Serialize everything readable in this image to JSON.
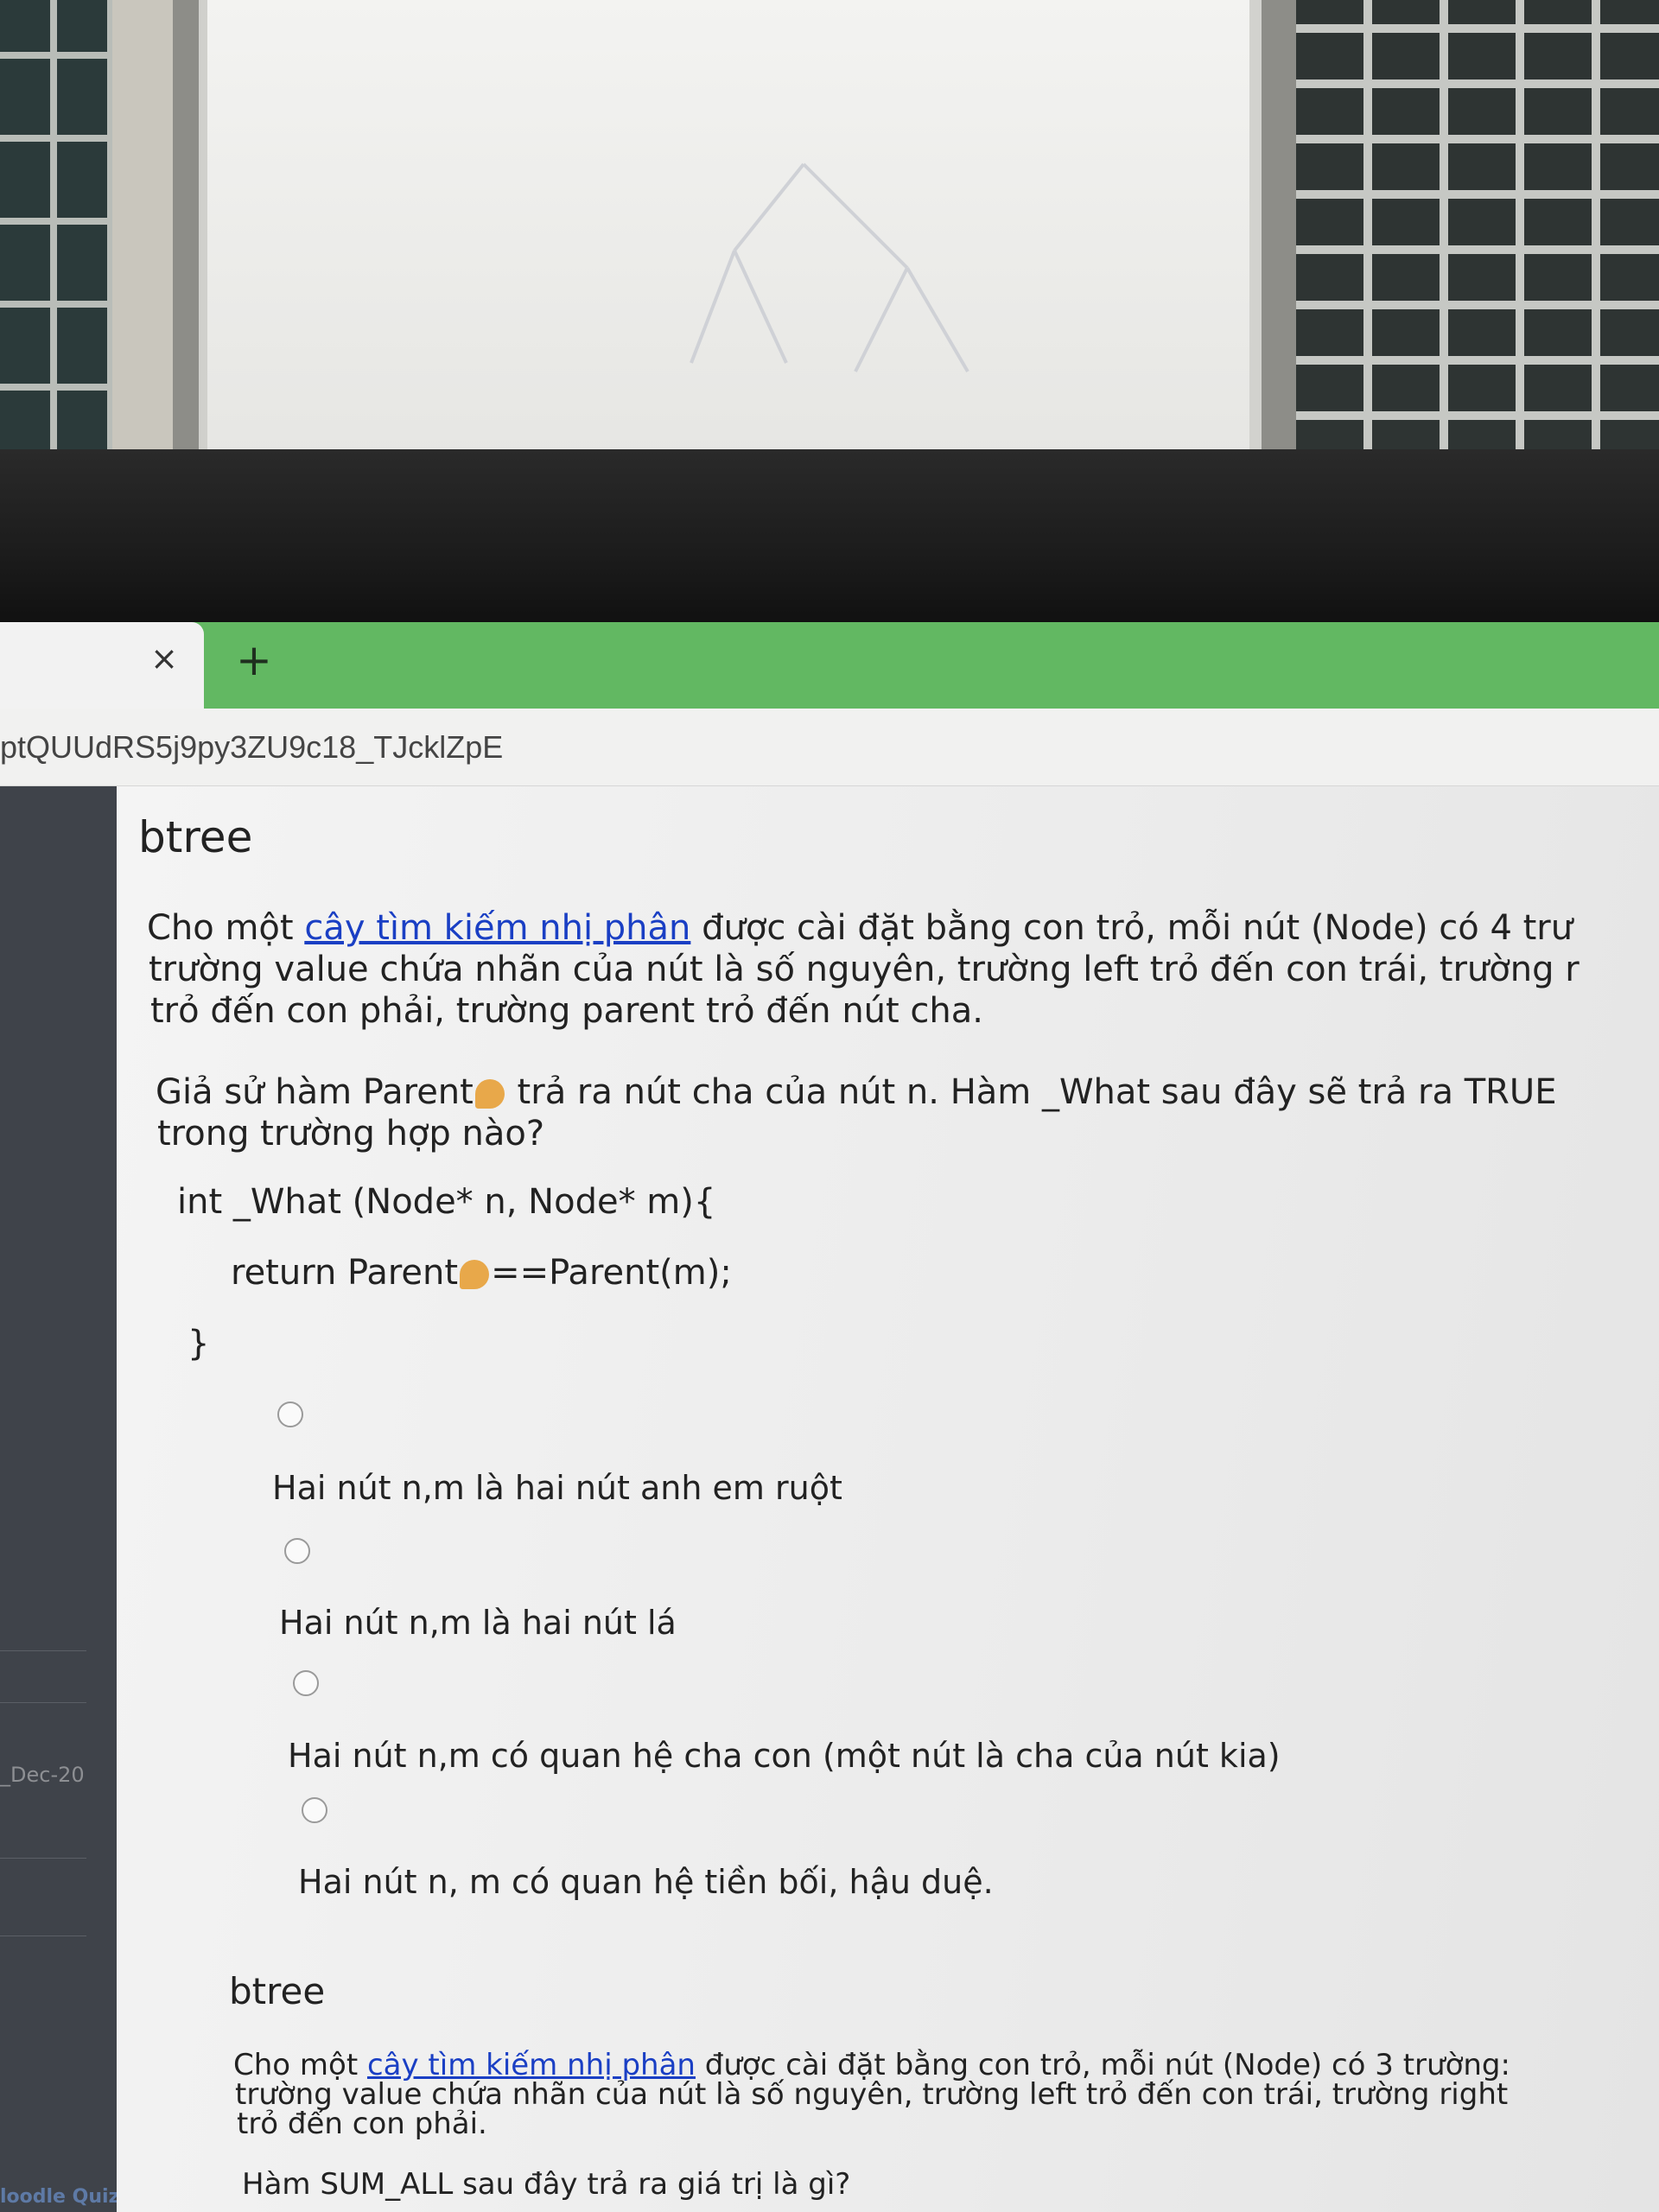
{
  "browser": {
    "tab_close_icon": "×",
    "new_tab_icon": "+",
    "url": "ptQUUdRS5j9py3ZU9c18_TJcklZpE"
  },
  "sidebar": {
    "date_fragment": "_Dec-20",
    "quiz_fragment": "loodle Quiz"
  },
  "question1": {
    "title": "btree",
    "para1_before_link": "Cho một ",
    "para1_link": "cây tìm kiếm nhị phân",
    "para1_after_link": " được cài đặt bằng con trỏ, mỗi nút (Node) có 4 trư",
    "para1_line2": "trường value chứa nhãn của nút là số nguyên, trường left trỏ đến con trái, trường r",
    "para1_line3": "trỏ đến con phải, trường parent trỏ đến nút cha.",
    "para2_part1": "Giả sử hàm Parent",
    "para2_part2": " trả ra nút cha của nút n. Hàm _What sau đây sẽ trả ra TRUE",
    "para2_line2": "trong trường hợp nào?",
    "code_line1": "int    _What (Node* n, Node* m){",
    "code_line2_a": "return Parent",
    "code_line2_b": "==Parent(m);",
    "code_line3": "}",
    "options": [
      "Hai nút n,m là hai nút anh em ruột",
      "Hai nút n,m là hai nút lá",
      "Hai nút n,m có quan hệ cha con (một nút là cha của nút kia)",
      "Hai nút n, m có quan hệ tiền bối, hậu duệ."
    ]
  },
  "question2": {
    "title": "btree",
    "para1_before_link": "Cho một ",
    "para1_link": "cây tìm kiếm nhị phân",
    "para1_after_link": " được cài đặt bằng con trỏ, mỗi nút (Node) có 3 trường:",
    "para1_line2": "trường value chứa nhãn của nút là số nguyên, trường left trỏ đến con trái, trường right",
    "para1_line3": "trỏ đến con phải.",
    "para2": "Hàm SUM_ALL sau đây trả ra giá trị là gì?"
  }
}
